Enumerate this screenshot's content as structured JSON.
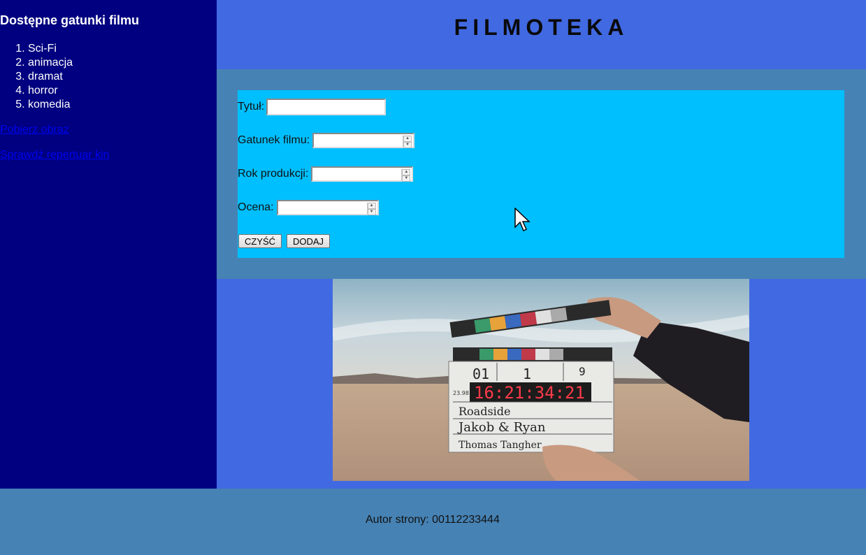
{
  "sidebar": {
    "heading": "Dostępne gatunki filmu",
    "genres": [
      "Sci-Fi",
      "animacja",
      "dramat",
      "horror",
      "komedia"
    ],
    "links": [
      "Pobierz obraz",
      "Sprawdź repertuar kin"
    ]
  },
  "header": {
    "title": "FILMOTEKA"
  },
  "form": {
    "title_label": "Tytuł:",
    "title_value": "",
    "genre_label": "Gatunek filmu:",
    "genre_value": "",
    "year_label": "Rok produkcji:",
    "year_value": "",
    "rating_label": "Ocena:",
    "rating_value": "",
    "clear_button": "CZYŚĆ",
    "add_button": "DODAJ"
  },
  "slate": {
    "scene": "01",
    "take": "1",
    "roll": "9",
    "timecode": "16:21:34:21",
    "fps": "23.98",
    "production": "Roadside",
    "director": "Jakob & Ryan",
    "camera": "Thomas Tangher"
  },
  "footer": {
    "author": "Autor strony: 00112233444"
  },
  "colors": {
    "sidebar": "#000080",
    "header": "#4169e1",
    "main": "#4682b4",
    "form": "#00bfff",
    "footer": "#4682b4"
  }
}
